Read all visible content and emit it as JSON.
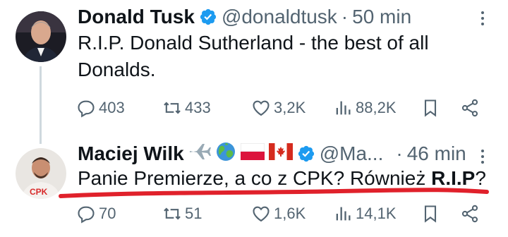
{
  "tweets": [
    {
      "name": "Donald Tusk",
      "handle": "@donaldtusk",
      "separator": "·",
      "time": "50 min",
      "text": "R.I.P. Donald Sutherland - the best of all Donalds.",
      "metrics": {
        "replies": "403",
        "retweets": "433",
        "likes": "3,2K",
        "views": "88,2K"
      }
    },
    {
      "name": "Maciej Wilk",
      "handle": "@Ma...",
      "separator": "·",
      "time": "46 min",
      "text_prefix": "Panie Premierze, a co z CPK? Również ",
      "text_bold": "R.I.P",
      "text_suffix": "?",
      "metrics": {
        "replies": "70",
        "retweets": "51",
        "likes": "1,6K",
        "views": "14,1K"
      }
    }
  ],
  "colors": {
    "text": "#0f1419",
    "secondary": "#536471",
    "verified": "#1d9bf0",
    "annotation": "#e0212b"
  },
  "icons": [
    "reply-icon",
    "retweet-icon",
    "like-icon",
    "views-icon",
    "bookmark-icon",
    "share-icon",
    "verified-icon",
    "more-icon"
  ]
}
